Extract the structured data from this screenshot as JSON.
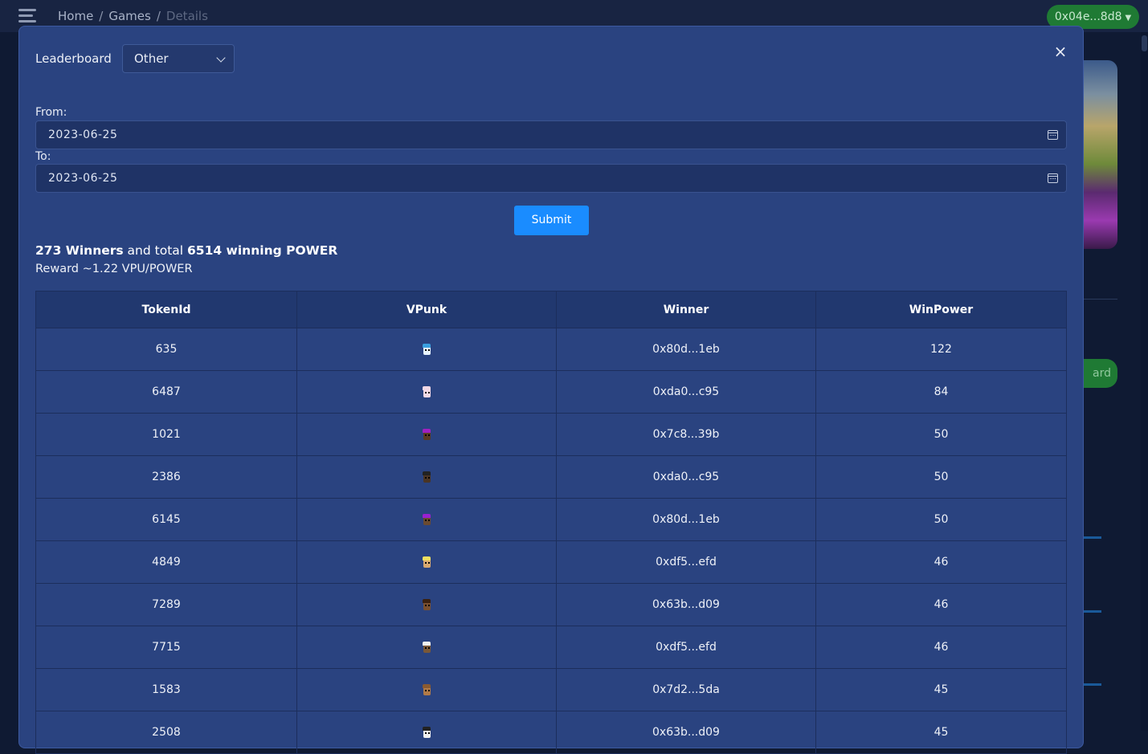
{
  "nav": {
    "breadcrumb": [
      "Home",
      "Games",
      "Details"
    ],
    "breadcrumb_sep": "/",
    "wallet_label": "0x04e...8d8"
  },
  "background": {
    "button_fragment": "ard"
  },
  "modal": {
    "close_label": "×",
    "leaderboard_label": "Leaderboard",
    "leaderboard_selected": "Other",
    "from_label": "From:",
    "from_value": "2023-06-25",
    "to_label": "To:",
    "to_value": "2023-06-25",
    "submit_label": "Submit",
    "summary": {
      "winners_count": "273 Winners",
      "middle_text": " and total ",
      "power_total": "6514 winning POWER"
    },
    "reward_text": "Reward ~1.22 VPU/POWER"
  },
  "table": {
    "headers": [
      "TokenId",
      "VPunk",
      "Winner",
      "WinPower"
    ],
    "rows": [
      {
        "token": "635",
        "punk": {
          "skin": "#e8f4ff",
          "hair": "#3aa0e0"
        },
        "winner": "0x80d...1eb",
        "power": "122"
      },
      {
        "token": "6487",
        "punk": {
          "skin": "#f3d9e6",
          "hair": "#f3d9e6"
        },
        "winner": "0xda0...c95",
        "power": "84"
      },
      {
        "token": "1021",
        "punk": {
          "skin": "#5a3a22",
          "hair": "#a020c0"
        },
        "winner": "0x7c8...39b",
        "power": "50"
      },
      {
        "token": "2386",
        "punk": {
          "skin": "#4a3525",
          "hair": "#222222"
        },
        "winner": "0xda0...c95",
        "power": "50"
      },
      {
        "token": "6145",
        "punk": {
          "skin": "#6a4a30",
          "hair": "#9a20d0"
        },
        "winner": "0x80d...1eb",
        "power": "50"
      },
      {
        "token": "4849",
        "punk": {
          "skin": "#d8a870",
          "hair": "#f0e060"
        },
        "winner": "0xdf5...efd",
        "power": "46"
      },
      {
        "token": "7289",
        "punk": {
          "skin": "#7a5030",
          "hair": "#3a2010"
        },
        "winner": "0x63b...d09",
        "power": "46"
      },
      {
        "token": "7715",
        "punk": {
          "skin": "#7a5838",
          "hair": "#f0f0f0"
        },
        "winner": "0xdf5...efd",
        "power": "46"
      },
      {
        "token": "1583",
        "punk": {
          "skin": "#b07a48",
          "hair": "#8a5a30"
        },
        "winner": "0x7d2...5da",
        "power": "45"
      },
      {
        "token": "2508",
        "punk": {
          "skin": "#f0f0f0",
          "hair": "#222222"
        },
        "winner": "0x63b...d09",
        "power": "45"
      }
    ]
  }
}
